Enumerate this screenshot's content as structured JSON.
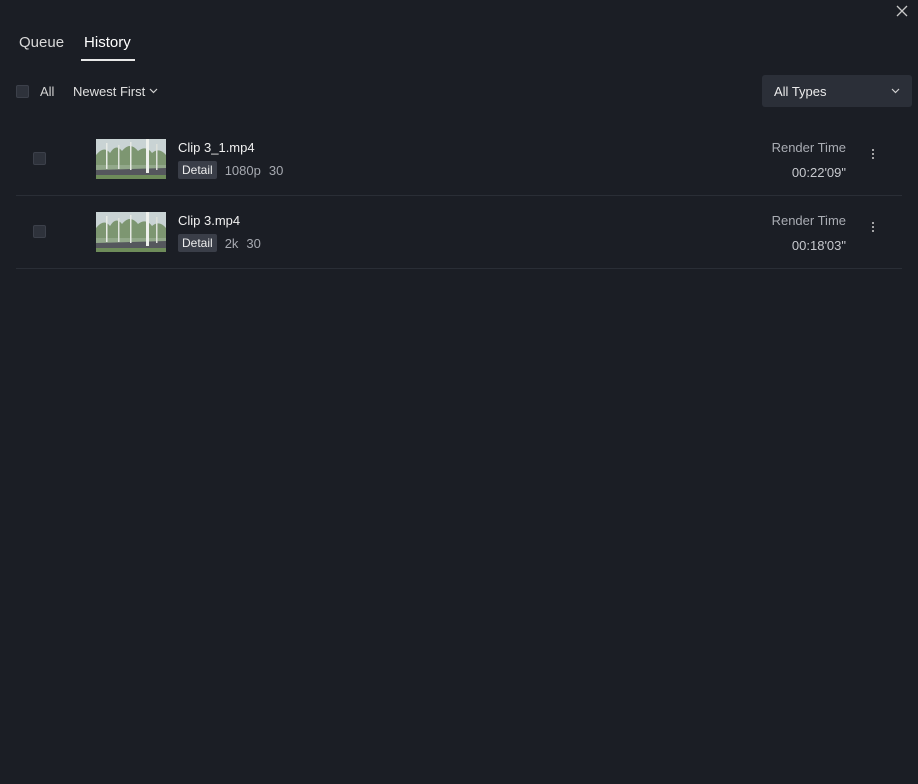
{
  "tabs": [
    {
      "label": "Queue",
      "active": false
    },
    {
      "label": "History",
      "active": true
    }
  ],
  "toolbar": {
    "select_all_label": "All",
    "sort_label": "Newest First",
    "type_filter_label": "All Types"
  },
  "items": [
    {
      "filename": "Clip 3_1.mp4",
      "badge": "Detail",
      "resolution": "1080p",
      "fps": "30",
      "render_time_label": "Render Time",
      "render_time": "00:22'09\""
    },
    {
      "filename": "Clip 3.mp4",
      "badge": "Detail",
      "resolution": "2k",
      "fps": "30",
      "render_time_label": "Render Time",
      "render_time": "00:18'03\""
    }
  ],
  "colors": {
    "background": "#1b1e25",
    "control_bg": "#2b2f38",
    "accent_underline": "#e8e8e8"
  }
}
